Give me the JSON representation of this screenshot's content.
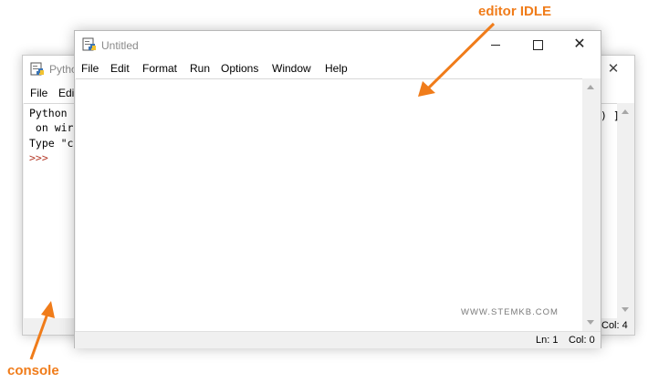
{
  "annotations": {
    "editor_label": "editor IDLE",
    "console_label": "console",
    "color": "#f07c1a"
  },
  "console_window": {
    "title": "Pytho",
    "menu": [
      "File",
      "Edi"
    ],
    "lines": [
      "Python",
      " on wir",
      "Type \"c"
    ],
    "prompt": ">>>",
    "right_tail": ") ]",
    "status_col": "Col: 4",
    "icons": [
      "python-app-icon",
      "close-icon"
    ]
  },
  "editor_window": {
    "title": "Untitled",
    "menu": [
      "File",
      "Edit",
      "Format",
      "Run",
      "Options",
      "Window",
      "Help"
    ],
    "controls": [
      "minimize-icon",
      "maximize-icon",
      "close-icon"
    ],
    "status": {
      "ln": "Ln: 1",
      "col": "Col: 0"
    },
    "watermark": "WWW.STEMKB.COM"
  }
}
